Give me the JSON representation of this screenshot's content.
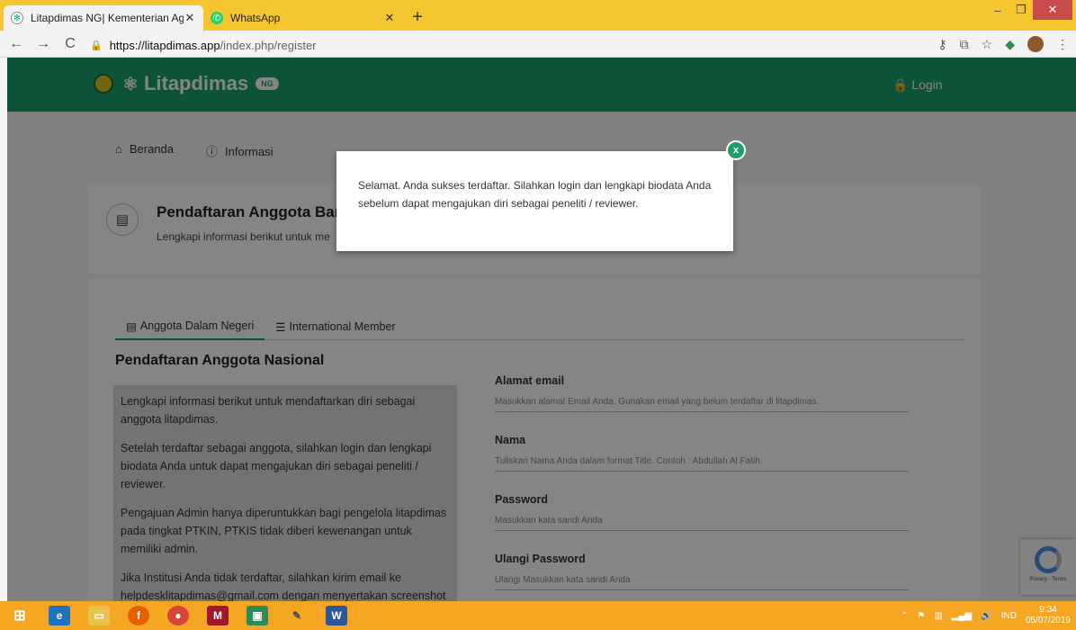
{
  "browser": {
    "tabs": [
      {
        "title": "Litapdimas NG| Kementerian Aga",
        "active": true
      },
      {
        "title": "WhatsApp",
        "active": false
      }
    ],
    "url_host": "https://litapdimas.app",
    "url_path": "/index.php/register"
  },
  "site": {
    "brand": "Litapdimas",
    "badge": "NG",
    "login": "Login",
    "nav": [
      "Beranda",
      "Informasi"
    ]
  },
  "header": {
    "title": "Pendaftaran Anggota Bar",
    "subtitle": "Lengkapi informasi berikut untuk me"
  },
  "tabs": [
    "Anggota Dalam Negeri",
    "International Member"
  ],
  "section_title": "Pendaftaran Anggota Nasional",
  "info_paragraphs": [
    "Lengkapi informasi berikut untuk mendaftarkan diri sebagai anggota litapdimas.",
    "Setelah terdaftar sebagai anggota, silahkan login dan lengkapi biodata Anda untuk dapat mengajukan diri sebagai peneliti / reviewer.",
    "Pengajuan Admin hanya diperuntukkan bagi pengelola litapdimas pada tingkat PTKIN, PTKIS tidak diberi kewenangan untuk memiliki admin.",
    "Jika Institusi Anda tidak terdaftar, silahkan kirim email ke helpdesklitapdimas@gmail.com dengan menyertakan screenshot data forlap PD-DIKTI mengenai institusi Anda."
  ],
  "fields": [
    {
      "label": "Alamat email",
      "placeholder": "Masukkan alamat Email Anda. Gunakan email yang belum terdaftar di litapdimas."
    },
    {
      "label": "Nama",
      "placeholder": "Tuliskan Nama Anda dalam format Title. Contoh : Abdullah Al Fatih"
    },
    {
      "label": "Password",
      "placeholder": "Masukkan kata sandi Anda"
    },
    {
      "label": "Ulangi Password",
      "placeholder": "Ulangi Masukkan kata sandi Anda"
    }
  ],
  "modal": {
    "message": "Selamat. Anda sukses terdaftar. Silahkan login dan lengkapi biodata Anda sebelum dapat mengajukan diri sebagai peneliti / reviewer.",
    "close": "x"
  },
  "recaptcha": {
    "terms": "Privacy - Terms"
  },
  "taskbar": {
    "lang": "IND",
    "time": "9:34",
    "date": "05/07/2019"
  },
  "colors": {
    "brand_green": "#1aa06a",
    "taskbar": "#f5a623",
    "tabbar": "#f6c631"
  }
}
